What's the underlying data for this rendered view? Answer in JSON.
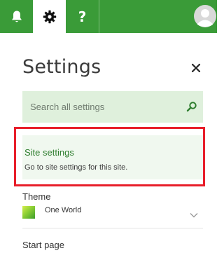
{
  "topbar": {
    "color": "#3a9b38",
    "buttons": [
      {
        "name": "notifications",
        "icon": "bell-icon"
      },
      {
        "name": "settings",
        "icon": "gear-icon",
        "active": true
      },
      {
        "name": "help",
        "icon": "help-icon",
        "label": "?"
      }
    ],
    "avatar_icon": "user-avatar-icon"
  },
  "settings_panel": {
    "title": "Settings",
    "close_icon": "close-icon",
    "search": {
      "placeholder": "Search all settings",
      "icon": "search-icon",
      "background": "#dff0dc"
    },
    "site_settings": {
      "title": "Site settings",
      "description": "Go to site settings for this site.",
      "highlight_color": "#e81e2a"
    },
    "theme": {
      "label": "Theme",
      "selected": "One World",
      "chevron_icon": "chevron-down-icon"
    },
    "start_page": {
      "label": "Start page"
    }
  }
}
